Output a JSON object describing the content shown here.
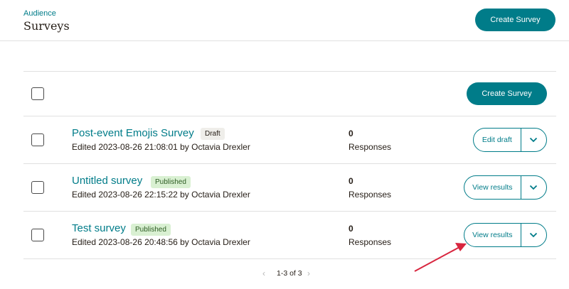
{
  "header": {
    "breadcrumb": "Audience",
    "title": "Surveys",
    "create_button": "Create Survey"
  },
  "table": {
    "create_button": "Create Survey",
    "rows": [
      {
        "title": "Post-event Emojis Survey",
        "status": "Draft",
        "edited": "Edited 2023-08-26 21:08:01 by Octavia Drexler",
        "count": "0",
        "count_label": "Responses",
        "action": "Edit draft"
      },
      {
        "title": "Untitled survey",
        "status": "Published",
        "edited": "Edited 2023-08-26 22:15:22 by Octavia Drexler",
        "count": "0",
        "count_label": "Responses",
        "action": "View results"
      },
      {
        "title": "Test survey",
        "status": "Published",
        "edited": "Edited 2023-08-26 20:48:56 by Octavia Drexler",
        "count": "0",
        "count_label": "Responses",
        "action": "View results"
      }
    ]
  },
  "pagination": {
    "text": "1-3 of 3",
    "prev_icon": "chevron-left-icon",
    "next_icon": "chevron-right-icon"
  },
  "colors": {
    "accent": "#007c89",
    "annotation": "#d8263f"
  }
}
